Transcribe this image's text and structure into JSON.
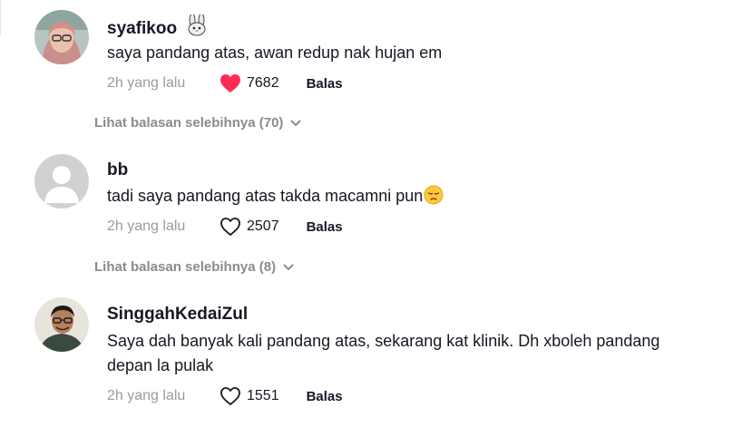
{
  "comments": [
    {
      "username": "syafikoo",
      "username_icon": "rabbit-emoji-icon",
      "text": "saya pandang atas, awan redup nak hujan em",
      "time": "2h yang lalu",
      "likes": "7682",
      "liked": true,
      "reply_label": "Balas",
      "view_replies": "Lihat balasan selebihnya (70)"
    },
    {
      "username": "bb",
      "text": "tadi saya pandang atas takda macamni pun",
      "text_emoji": "pensive-face-emoji-icon",
      "time": "2h yang lalu",
      "likes": "2507",
      "liked": false,
      "reply_label": "Balas",
      "view_replies": "Lihat balasan selebihnya (8)"
    },
    {
      "username": "SinggahKedaiZul",
      "text_line1": "Saya dah banyak kali pandang atas, sekarang kat klinik. Dh xboleh pandang",
      "text_line2": "depan la pulak",
      "time": "2h yang lalu",
      "likes": "1551",
      "liked": false,
      "reply_label": "Balas"
    }
  ],
  "colors": {
    "like_active": "#fe2c55",
    "muted": "#9a9ba2",
    "text": "#161823"
  }
}
